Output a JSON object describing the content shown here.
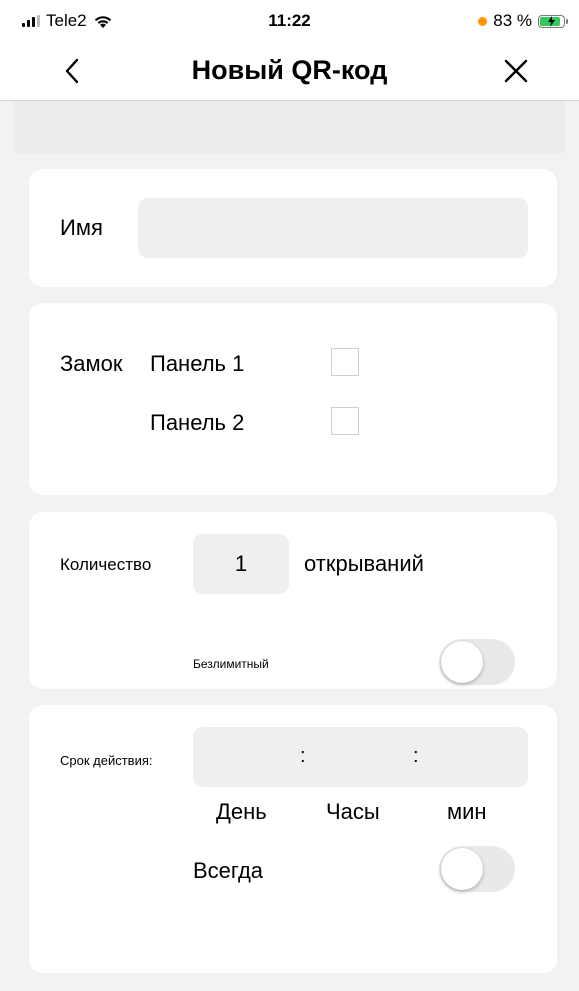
{
  "status_bar": {
    "carrier": "Tele2",
    "time": "11:22",
    "battery_percent": "83 %",
    "battery_level": 0.83,
    "signal_bars": 3,
    "icons": [
      "signal-icon",
      "wifi-icon",
      "battery-charging-icon"
    ],
    "colors": {
      "battery_fill": "#34c759",
      "indicator_dot": "#ff9500"
    }
  },
  "nav": {
    "title": "Новый QR-код",
    "back_icon": "chevron-left-icon",
    "close_icon": "close-icon"
  },
  "name_card": {
    "label": "Имя",
    "value": "",
    "placeholder": ""
  },
  "lock_card": {
    "label": "Замок",
    "panels": [
      {
        "label": "Панель 1",
        "checked": false
      },
      {
        "label": "Панель 2",
        "checked": false
      }
    ]
  },
  "count_card": {
    "label": "Количество",
    "value": "1",
    "suffix": "открываний",
    "unlimited_label": "Безлимитный",
    "unlimited_on": false
  },
  "validity_card": {
    "label": "Срок действия:",
    "separators": [
      ":",
      ":"
    ],
    "day_value": "",
    "hours_value": "",
    "minutes_value": "",
    "units": {
      "day": "День",
      "hours": "Часы",
      "minutes": "мин"
    },
    "always_label": "Всегда",
    "always_on": false
  }
}
